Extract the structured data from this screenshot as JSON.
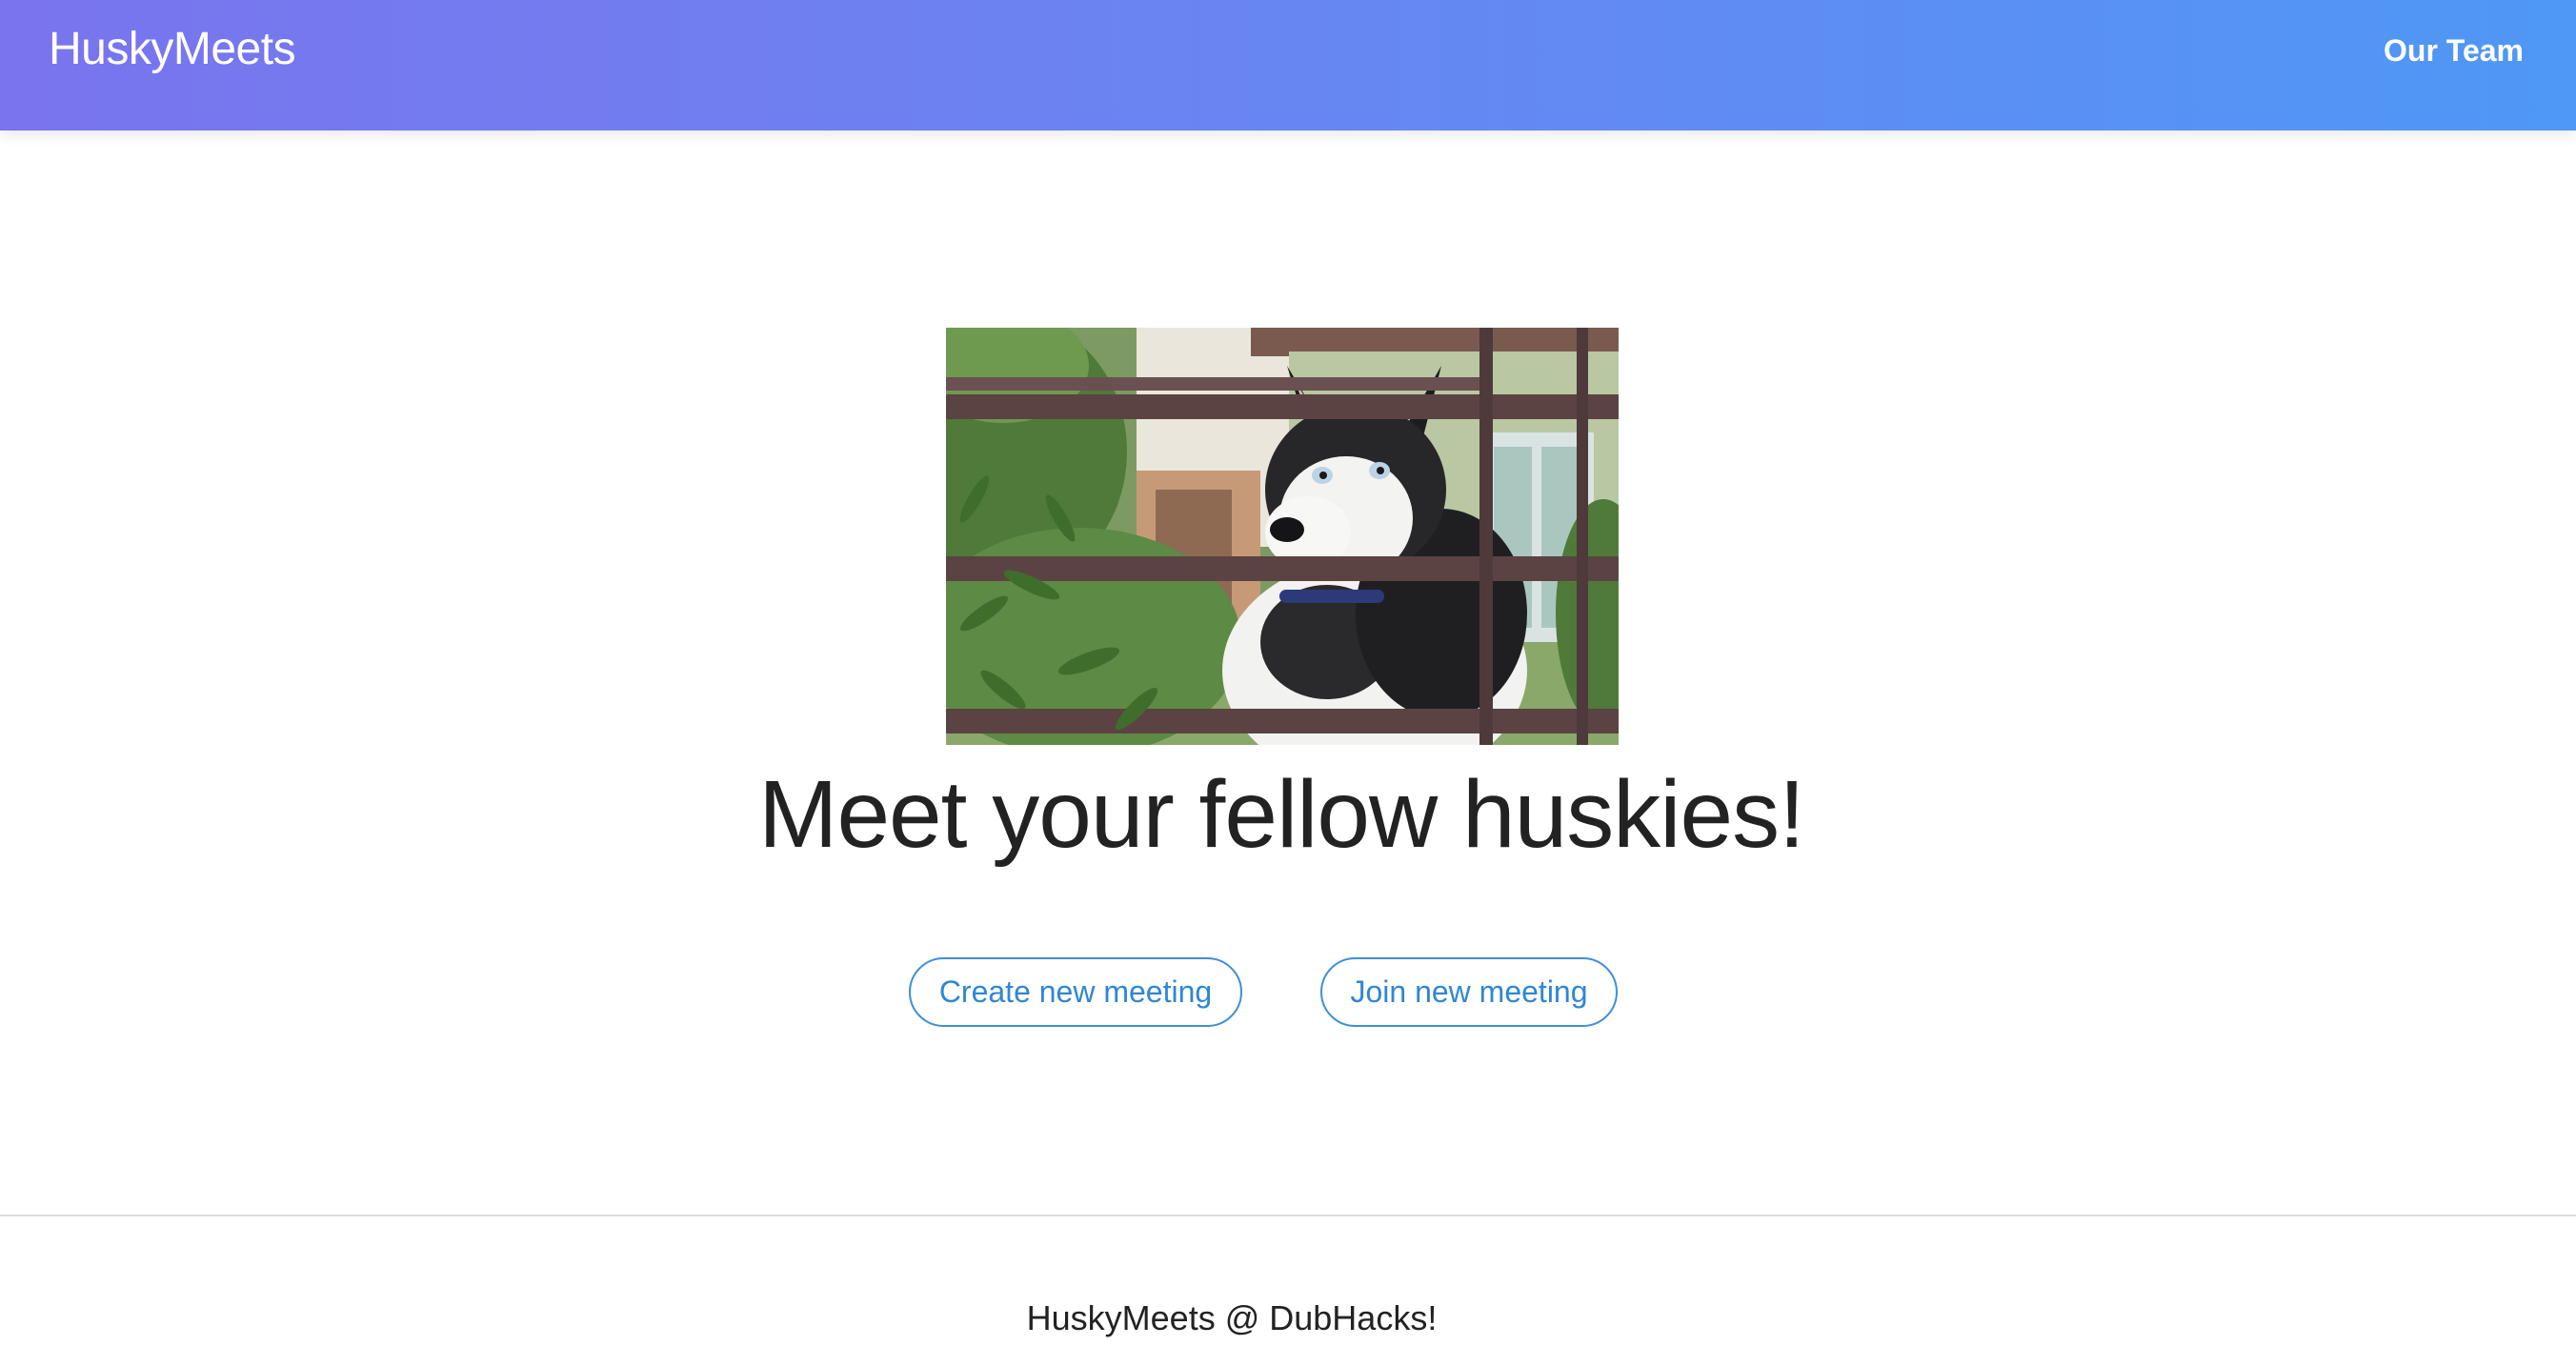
{
  "navbar": {
    "brand": "HuskyMeets",
    "links": [
      {
        "label": "Our Team"
      }
    ]
  },
  "hero": {
    "image_subject": "husky-behind-fence",
    "title": "Meet your fellow huskies!"
  },
  "actions": {
    "create_label": "Create new meeting",
    "join_label": "Join new meeting"
  },
  "footer": {
    "text": "HuskyMeets @ DubHacks!"
  },
  "colors": {
    "nav_gradient_start": "#7a74ee",
    "nav_gradient_end": "#4f98f5",
    "button_accent": "#3d8fd8",
    "text": "#222222"
  }
}
